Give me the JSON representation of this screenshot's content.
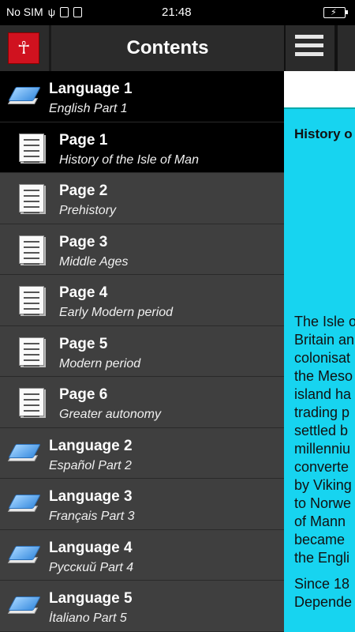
{
  "status_bar": {
    "carrier": "No SIM",
    "time": "21:48"
  },
  "drawer": {
    "title": "Contents",
    "items": [
      {
        "kind": "lang",
        "title": "Language 1",
        "subtitle": "English Part 1"
      },
      {
        "kind": "page",
        "title": "Page 1",
        "subtitle": "History of the Isle of Man",
        "active": true
      },
      {
        "kind": "page",
        "title": "Page 2",
        "subtitle": "Prehistory"
      },
      {
        "kind": "page",
        "title": "Page 3",
        "subtitle": "Middle Ages"
      },
      {
        "kind": "page",
        "title": "Page 4",
        "subtitle": "Early Modern period"
      },
      {
        "kind": "page",
        "title": "Page 5",
        "subtitle": "Modern period"
      },
      {
        "kind": "page",
        "title": "Page 6",
        "subtitle": "Greater autonomy"
      },
      {
        "kind": "lang",
        "title": "Language 2",
        "subtitle": "Español Part 2"
      },
      {
        "kind": "lang",
        "title": "Language 3",
        "subtitle": "Français Part 3"
      },
      {
        "kind": "lang",
        "title": "Language 4",
        "subtitle": "Русский Part 4"
      },
      {
        "kind": "lang",
        "title": "Language 5",
        "subtitle": "İtaliano Part 5"
      }
    ]
  },
  "main": {
    "heading": "History o",
    "body_lines_1": [
      "The Isle o",
      "Britain an",
      "colonisat",
      "the Meso",
      "island ha",
      "trading p",
      "settled b",
      "millenniu",
      "converte",
      "by Viking",
      "to Norwe",
      "of Mann",
      "became",
      "the Engli"
    ],
    "body_lines_2": [
      "Since 18",
      "Depende"
    ]
  },
  "icons": {
    "menu": "hamburger-menu-icon",
    "app": "triskelion-app-icon",
    "lang_item": "book-icon",
    "page_item": "document-icon"
  },
  "colors": {
    "accent_cyan": "#17d4f0",
    "drawer_bg": "#3f3f3f",
    "active_bg": "#000000"
  }
}
